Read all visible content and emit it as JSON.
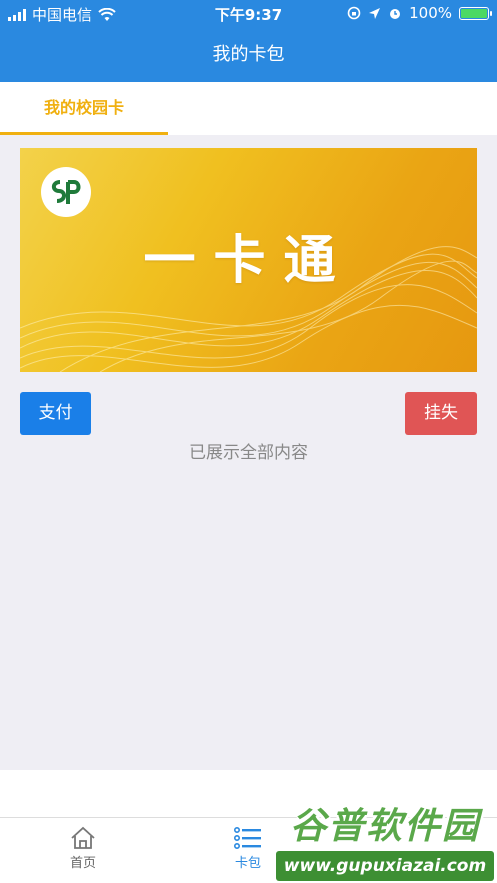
{
  "status_bar": {
    "carrier": "中国电信",
    "time": "下午9:37",
    "battery": "100%"
  },
  "nav": {
    "title": "我的卡包"
  },
  "tabs": [
    {
      "label": "我的校园卡",
      "active": true
    }
  ],
  "card": {
    "title": "一卡通",
    "logo": "school-logo"
  },
  "actions": {
    "pay": "支付",
    "report_lost": "挂失"
  },
  "list_end": "已展示全部内容",
  "tabbar": [
    {
      "label": "首页",
      "icon": "home-icon"
    },
    {
      "label": "卡包",
      "icon": "list-icon",
      "active": true
    }
  ],
  "watermark": {
    "brand": "谷普软件园",
    "url": "www.gupuxiazai.com"
  },
  "colors": {
    "primary": "#2a89e0",
    "accent": "#f0b010",
    "pay": "#1a7fe8",
    "danger": "#e05555",
    "battery": "#4cd964"
  }
}
